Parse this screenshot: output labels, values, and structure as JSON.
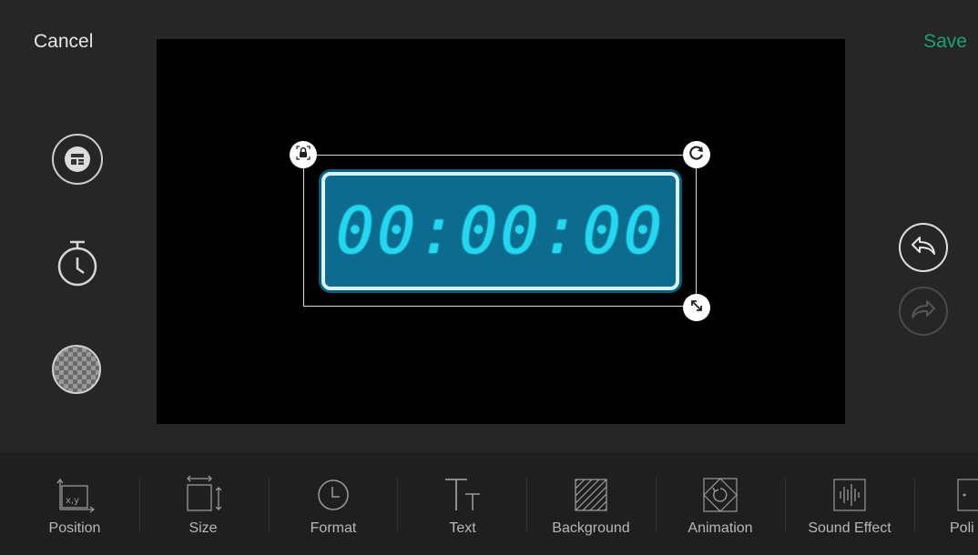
{
  "header": {
    "cancel_label": "Cancel",
    "save_label": "Save"
  },
  "colors": {
    "background": "#262626",
    "toolbar": "#1f1f1f",
    "save_accent": "#1aa374",
    "timer_digits": "#22d7ef",
    "timer_box": "#0d6b8d"
  },
  "side_tools": [
    {
      "icon": "layout-icon"
    },
    {
      "icon": "stopwatch-icon"
    },
    {
      "icon": "transparency-icon"
    }
  ],
  "timer": {
    "display": "00:00:00"
  },
  "handles": {
    "lock": "lock-icon",
    "rotate": "rotate-icon",
    "resize": "resize-icon"
  },
  "history": {
    "undo_icon": "undo-icon",
    "redo_icon": "redo-icon"
  },
  "toolbar": {
    "items": [
      {
        "label": "Position",
        "icon": "position-icon"
      },
      {
        "label": "Size",
        "icon": "size-icon"
      },
      {
        "label": "Format",
        "icon": "clock-icon"
      },
      {
        "label": "Text",
        "icon": "text-icon"
      },
      {
        "label": "Background",
        "icon": "background-icon"
      },
      {
        "label": "Animation",
        "icon": "animation-icon"
      },
      {
        "label": "Sound Effect",
        "icon": "sound-effect-icon"
      },
      {
        "label": "Poli",
        "icon": "policy-icon"
      }
    ]
  },
  "position_icon_text": "x,y"
}
